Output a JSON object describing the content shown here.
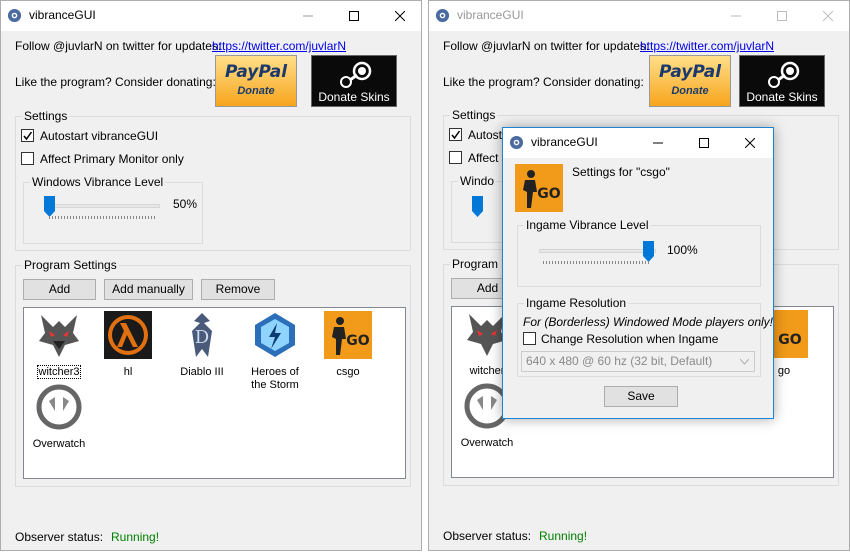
{
  "left": {
    "title": "vibranceGUI",
    "follow_text": "Follow @juvlarN on twitter for updates:",
    "twitter_link": "https://twitter.com/juvlarN",
    "donate_text": "Like the program? Consider donating:",
    "paypal": {
      "word": "PayPal",
      "sub": "Donate"
    },
    "steam_label": "Donate Skins",
    "settings": {
      "title": "Settings",
      "autostart": {
        "label": "Autostart vibranceGUI",
        "checked": true
      },
      "primary": {
        "label": "Affect Primary Monitor only",
        "checked": false
      },
      "vibrance": {
        "title": "Windows Vibrance Level",
        "value_text": "50%",
        "value": 0.0
      }
    },
    "program_settings": {
      "title": "Program Settings",
      "buttons": {
        "add": "Add",
        "manual": "Add manually",
        "remove": "Remove"
      },
      "programs": [
        "witcher3",
        "hl",
        "Diablo III",
        "Heroes of the Storm",
        "csgo",
        "Overwatch"
      ]
    },
    "observer": {
      "label": "Observer status:",
      "value": "Running!",
      "color": "#008000"
    }
  },
  "right": {
    "title": "vibranceGUI",
    "follow_text": "Follow @juvlarN on twitter for updates:",
    "twitter_link": "https://twitter.com/juvlarN",
    "donate_text": "Like the program? Consider donating:",
    "steam_label": "Donate Skins",
    "settings_title": "Settings",
    "autostart_partial": "Autosta",
    "affect_partial": "Affect P",
    "windows_partial": "Windo",
    "program_partial": "Program Se",
    "add": "Add",
    "programs": [
      "witcher",
      "go",
      "Overwatch"
    ],
    "observer": {
      "label": "Observer status:",
      "value": "Running!"
    }
  },
  "dialog": {
    "title": "vibranceGUI",
    "settings_for": "Settings for \"csgo\"",
    "ingame_vibrance": {
      "title": "Ingame Vibrance Level",
      "value_text": "100%",
      "value": 1.0
    },
    "resolution": {
      "title": "Ingame Resolution",
      "note": "For (Borderless) Windowed Mode players only!",
      "change_label": "Change Resolution when Ingame",
      "selected": "640 x 480 @ 60 hz (32 bit, Default)"
    },
    "save": "Save"
  },
  "colors": {
    "accent": "#0078d7",
    "running": "#008000",
    "link": "#0000ee"
  }
}
